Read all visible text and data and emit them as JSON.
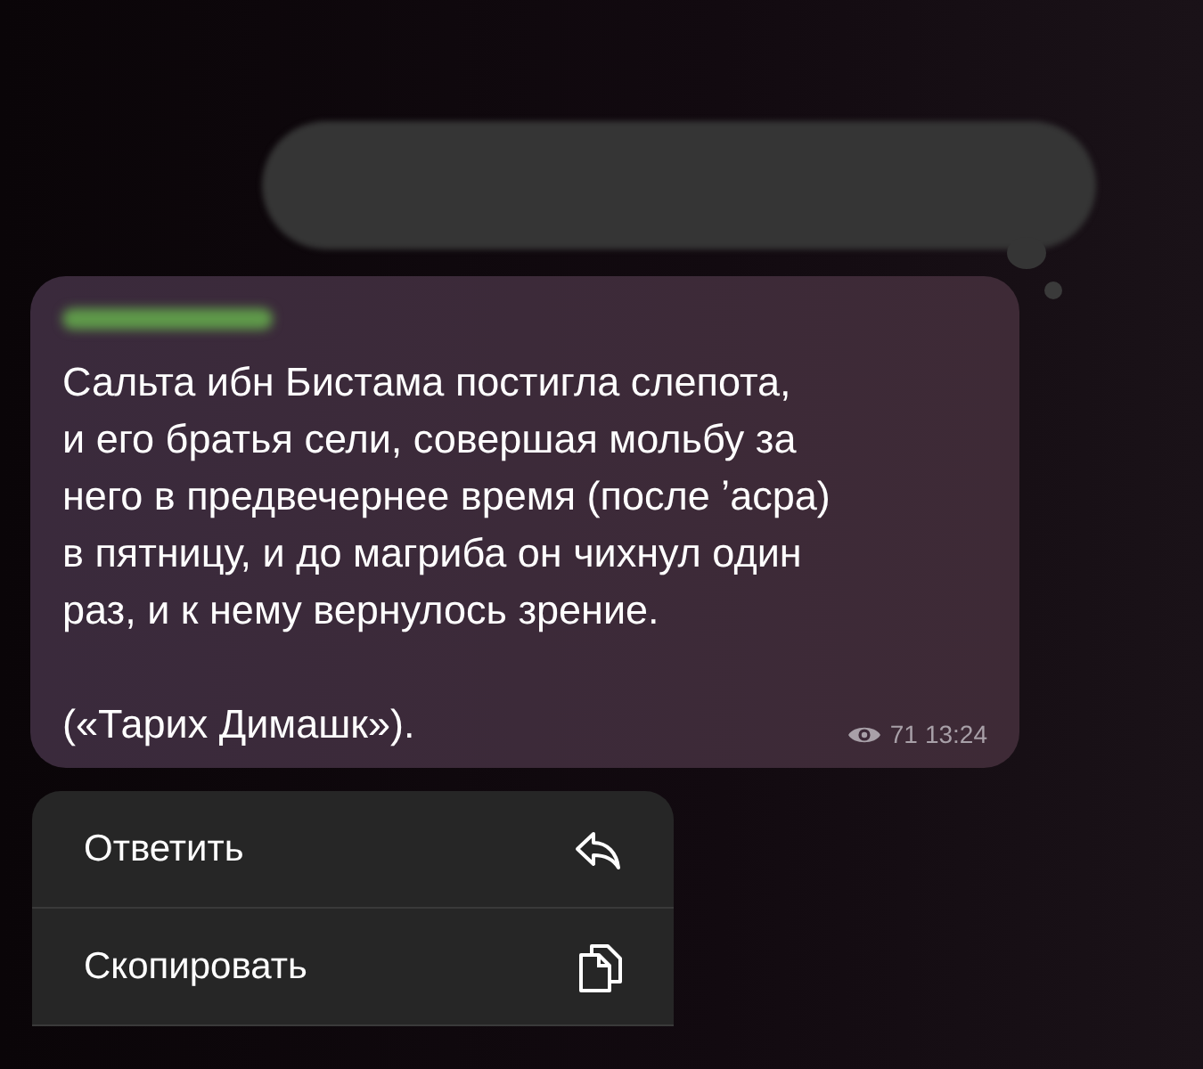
{
  "message": {
    "paragraphs": [
      "Сальта ибн Бистама постигла слепота,\nи его братья сели, совершая мольбу за\nнего в предвечернее время (после ʼасра)\nв пятницу, и до магриба он чихнул один\nраз, и к нему вернулось зрение.",
      "(«Тарих Димашк»)."
    ],
    "views": "71",
    "time": "13:24"
  },
  "menu": [
    {
      "label": "Ответить",
      "kind": "reply"
    },
    {
      "label": "Скопировать",
      "kind": "copy"
    }
  ]
}
